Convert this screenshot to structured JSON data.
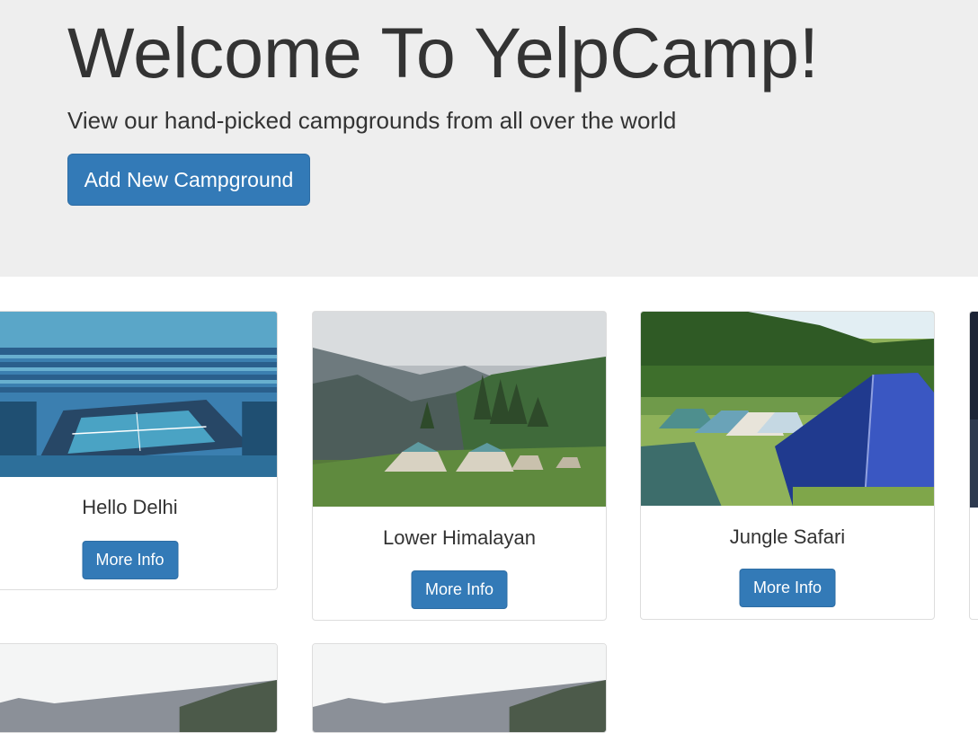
{
  "jumbotron": {
    "title": "Welcome To YelpCamp!",
    "subtitle": "View our hand-picked campgrounds from all over the world",
    "add_button_label": "Add New Campground"
  },
  "colors": {
    "primary": "#337ab7",
    "jumbotron_bg": "#eeeeee",
    "text": "#333333"
  },
  "campgrounds": [
    {
      "name": "Hello Delhi",
      "button_label": "More Info",
      "image": "tennis-stadium-image"
    },
    {
      "name": "Lower Himalayan",
      "button_label": "More Info",
      "image": "mountain-tents-image"
    },
    {
      "name": "Jungle Safari",
      "button_label": "More Info",
      "image": "forest-tents-image"
    }
  ]
}
